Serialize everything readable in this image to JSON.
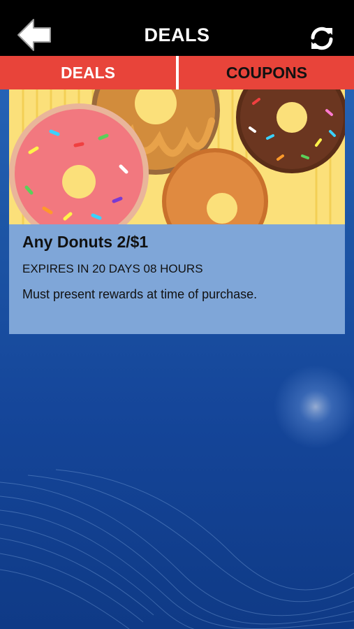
{
  "header": {
    "title": "DEALS",
    "back_icon": "back-arrow-icon",
    "refresh_icon": "refresh-icon"
  },
  "tabs": [
    {
      "label": "DEALS",
      "active": true
    },
    {
      "label": "COUPONS",
      "active": false
    }
  ],
  "deal": {
    "title": "Any Donuts 2/$1",
    "expiry": "EXPIRES IN 20 DAYS 08 HOURS",
    "description": "Must present rewards at time of purchase."
  },
  "colors": {
    "top_bar": "#000000",
    "tab_bar": "#e8443a",
    "card_background": "#7fa6d8",
    "page_background": "#1d56a6"
  }
}
